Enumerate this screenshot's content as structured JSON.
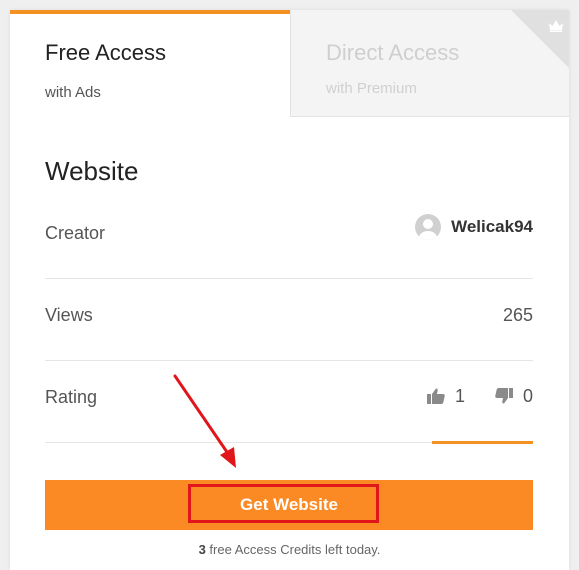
{
  "tabs": {
    "free": {
      "title": "Free Access",
      "subtitle": "with Ads"
    },
    "direct": {
      "title": "Direct Access",
      "subtitle": "with Premium",
      "badge_icon": "crown-icon"
    }
  },
  "section": {
    "title": "Website"
  },
  "details": {
    "creator": {
      "label": "Creator",
      "name": "Welicak94",
      "avatar_icon": "user-avatar-icon"
    },
    "views": {
      "label": "Views",
      "value": "265"
    },
    "rating": {
      "label": "Rating",
      "likes": "1",
      "dislikes": "0"
    }
  },
  "action": {
    "button_label": "Get Website"
  },
  "credits": {
    "count": "3",
    "text": "free Access Credits left today."
  },
  "colors": {
    "accent": "#fb8a24",
    "tab_accent": "#f39122",
    "annotation": "#e0161b"
  }
}
